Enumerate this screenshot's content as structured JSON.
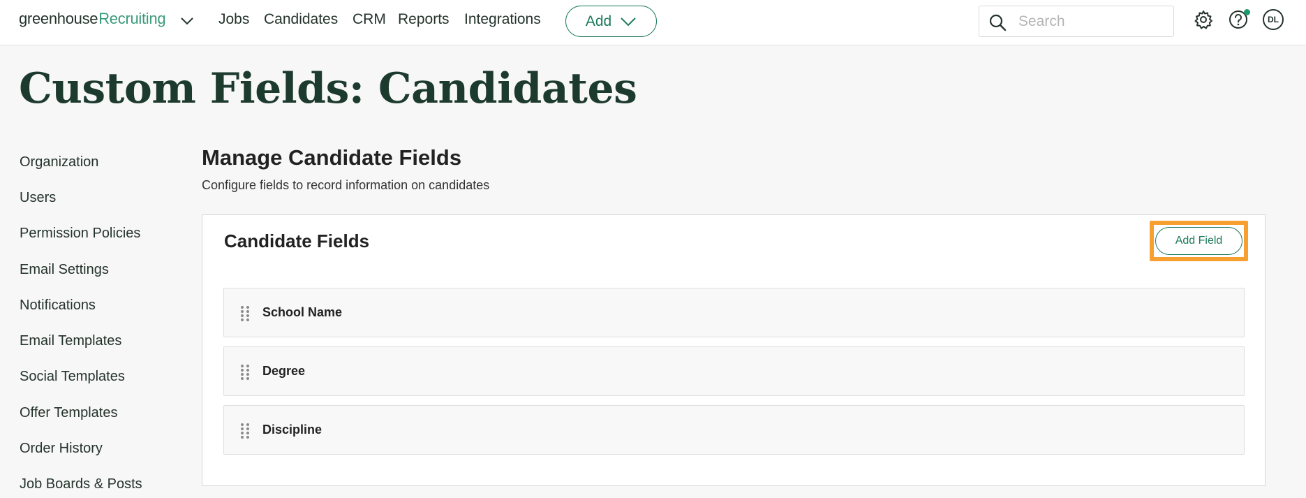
{
  "header": {
    "logo_brand": "greenhouse",
    "logo_product": "Recruiting",
    "nav": [
      "Jobs",
      "Candidates",
      "CRM",
      "Reports",
      "Integrations"
    ],
    "add_label": "Add",
    "search_placeholder": "Search",
    "icons": [
      "gear-icon",
      "help-icon"
    ],
    "avatar_initials": "DL"
  },
  "page": {
    "title": "Custom Fields: Candidates"
  },
  "sidebar": {
    "items": [
      "Organization",
      "Users",
      "Permission Policies",
      "Email Settings",
      "Notifications",
      "Email Templates",
      "Social Templates",
      "Offer Templates",
      "Order History",
      "Job Boards & Posts"
    ]
  },
  "main": {
    "heading": "Manage Candidate Fields",
    "subheading": "Configure fields to record information on candidates",
    "panel_title": "Candidate Fields",
    "add_field_label": "Add Field",
    "fields": [
      "School Name",
      "Degree",
      "Discipline"
    ]
  },
  "colors": {
    "accent": "#1d7a5c",
    "highlight": "#f7a030",
    "title": "#1d3a2f"
  }
}
